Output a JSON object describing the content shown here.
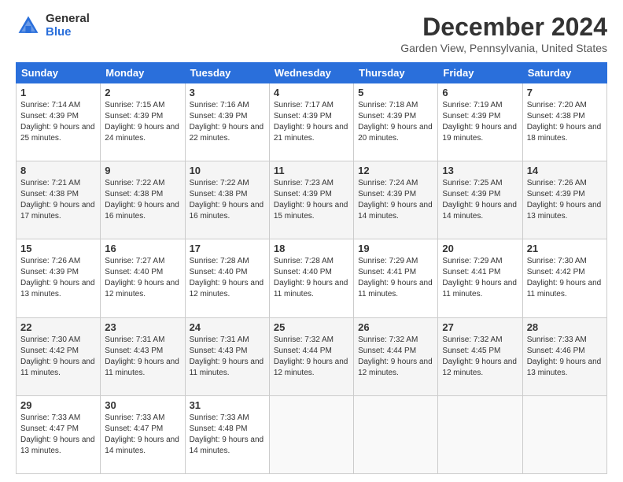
{
  "header": {
    "logo_general": "General",
    "logo_blue": "Blue",
    "title": "December 2024",
    "location": "Garden View, Pennsylvania, United States"
  },
  "days_of_week": [
    "Sunday",
    "Monday",
    "Tuesday",
    "Wednesday",
    "Thursday",
    "Friday",
    "Saturday"
  ],
  "weeks": [
    [
      {
        "num": "1",
        "sunrise": "7:14 AM",
        "sunset": "4:39 PM",
        "daylight": "9 hours and 25 minutes."
      },
      {
        "num": "2",
        "sunrise": "7:15 AM",
        "sunset": "4:39 PM",
        "daylight": "9 hours and 24 minutes."
      },
      {
        "num": "3",
        "sunrise": "7:16 AM",
        "sunset": "4:39 PM",
        "daylight": "9 hours and 22 minutes."
      },
      {
        "num": "4",
        "sunrise": "7:17 AM",
        "sunset": "4:39 PM",
        "daylight": "9 hours and 21 minutes."
      },
      {
        "num": "5",
        "sunrise": "7:18 AM",
        "sunset": "4:39 PM",
        "daylight": "9 hours and 20 minutes."
      },
      {
        "num": "6",
        "sunrise": "7:19 AM",
        "sunset": "4:39 PM",
        "daylight": "9 hours and 19 minutes."
      },
      {
        "num": "7",
        "sunrise": "7:20 AM",
        "sunset": "4:38 PM",
        "daylight": "9 hours and 18 minutes."
      }
    ],
    [
      {
        "num": "8",
        "sunrise": "7:21 AM",
        "sunset": "4:38 PM",
        "daylight": "9 hours and 17 minutes."
      },
      {
        "num": "9",
        "sunrise": "7:22 AM",
        "sunset": "4:38 PM",
        "daylight": "9 hours and 16 minutes."
      },
      {
        "num": "10",
        "sunrise": "7:22 AM",
        "sunset": "4:38 PM",
        "daylight": "9 hours and 16 minutes."
      },
      {
        "num": "11",
        "sunrise": "7:23 AM",
        "sunset": "4:39 PM",
        "daylight": "9 hours and 15 minutes."
      },
      {
        "num": "12",
        "sunrise": "7:24 AM",
        "sunset": "4:39 PM",
        "daylight": "9 hours and 14 minutes."
      },
      {
        "num": "13",
        "sunrise": "7:25 AM",
        "sunset": "4:39 PM",
        "daylight": "9 hours and 14 minutes."
      },
      {
        "num": "14",
        "sunrise": "7:26 AM",
        "sunset": "4:39 PM",
        "daylight": "9 hours and 13 minutes."
      }
    ],
    [
      {
        "num": "15",
        "sunrise": "7:26 AM",
        "sunset": "4:39 PM",
        "daylight": "9 hours and 13 minutes."
      },
      {
        "num": "16",
        "sunrise": "7:27 AM",
        "sunset": "4:40 PM",
        "daylight": "9 hours and 12 minutes."
      },
      {
        "num": "17",
        "sunrise": "7:28 AM",
        "sunset": "4:40 PM",
        "daylight": "9 hours and 12 minutes."
      },
      {
        "num": "18",
        "sunrise": "7:28 AM",
        "sunset": "4:40 PM",
        "daylight": "9 hours and 11 minutes."
      },
      {
        "num": "19",
        "sunrise": "7:29 AM",
        "sunset": "4:41 PM",
        "daylight": "9 hours and 11 minutes."
      },
      {
        "num": "20",
        "sunrise": "7:29 AM",
        "sunset": "4:41 PM",
        "daylight": "9 hours and 11 minutes."
      },
      {
        "num": "21",
        "sunrise": "7:30 AM",
        "sunset": "4:42 PM",
        "daylight": "9 hours and 11 minutes."
      }
    ],
    [
      {
        "num": "22",
        "sunrise": "7:30 AM",
        "sunset": "4:42 PM",
        "daylight": "9 hours and 11 minutes."
      },
      {
        "num": "23",
        "sunrise": "7:31 AM",
        "sunset": "4:43 PM",
        "daylight": "9 hours and 11 minutes."
      },
      {
        "num": "24",
        "sunrise": "7:31 AM",
        "sunset": "4:43 PM",
        "daylight": "9 hours and 11 minutes."
      },
      {
        "num": "25",
        "sunrise": "7:32 AM",
        "sunset": "4:44 PM",
        "daylight": "9 hours and 12 minutes."
      },
      {
        "num": "26",
        "sunrise": "7:32 AM",
        "sunset": "4:44 PM",
        "daylight": "9 hours and 12 minutes."
      },
      {
        "num": "27",
        "sunrise": "7:32 AM",
        "sunset": "4:45 PM",
        "daylight": "9 hours and 12 minutes."
      },
      {
        "num": "28",
        "sunrise": "7:33 AM",
        "sunset": "4:46 PM",
        "daylight": "9 hours and 13 minutes."
      }
    ],
    [
      {
        "num": "29",
        "sunrise": "7:33 AM",
        "sunset": "4:47 PM",
        "daylight": "9 hours and 13 minutes."
      },
      {
        "num": "30",
        "sunrise": "7:33 AM",
        "sunset": "4:47 PM",
        "daylight": "9 hours and 14 minutes."
      },
      {
        "num": "31",
        "sunrise": "7:33 AM",
        "sunset": "4:48 PM",
        "daylight": "9 hours and 14 minutes."
      },
      null,
      null,
      null,
      null
    ]
  ]
}
